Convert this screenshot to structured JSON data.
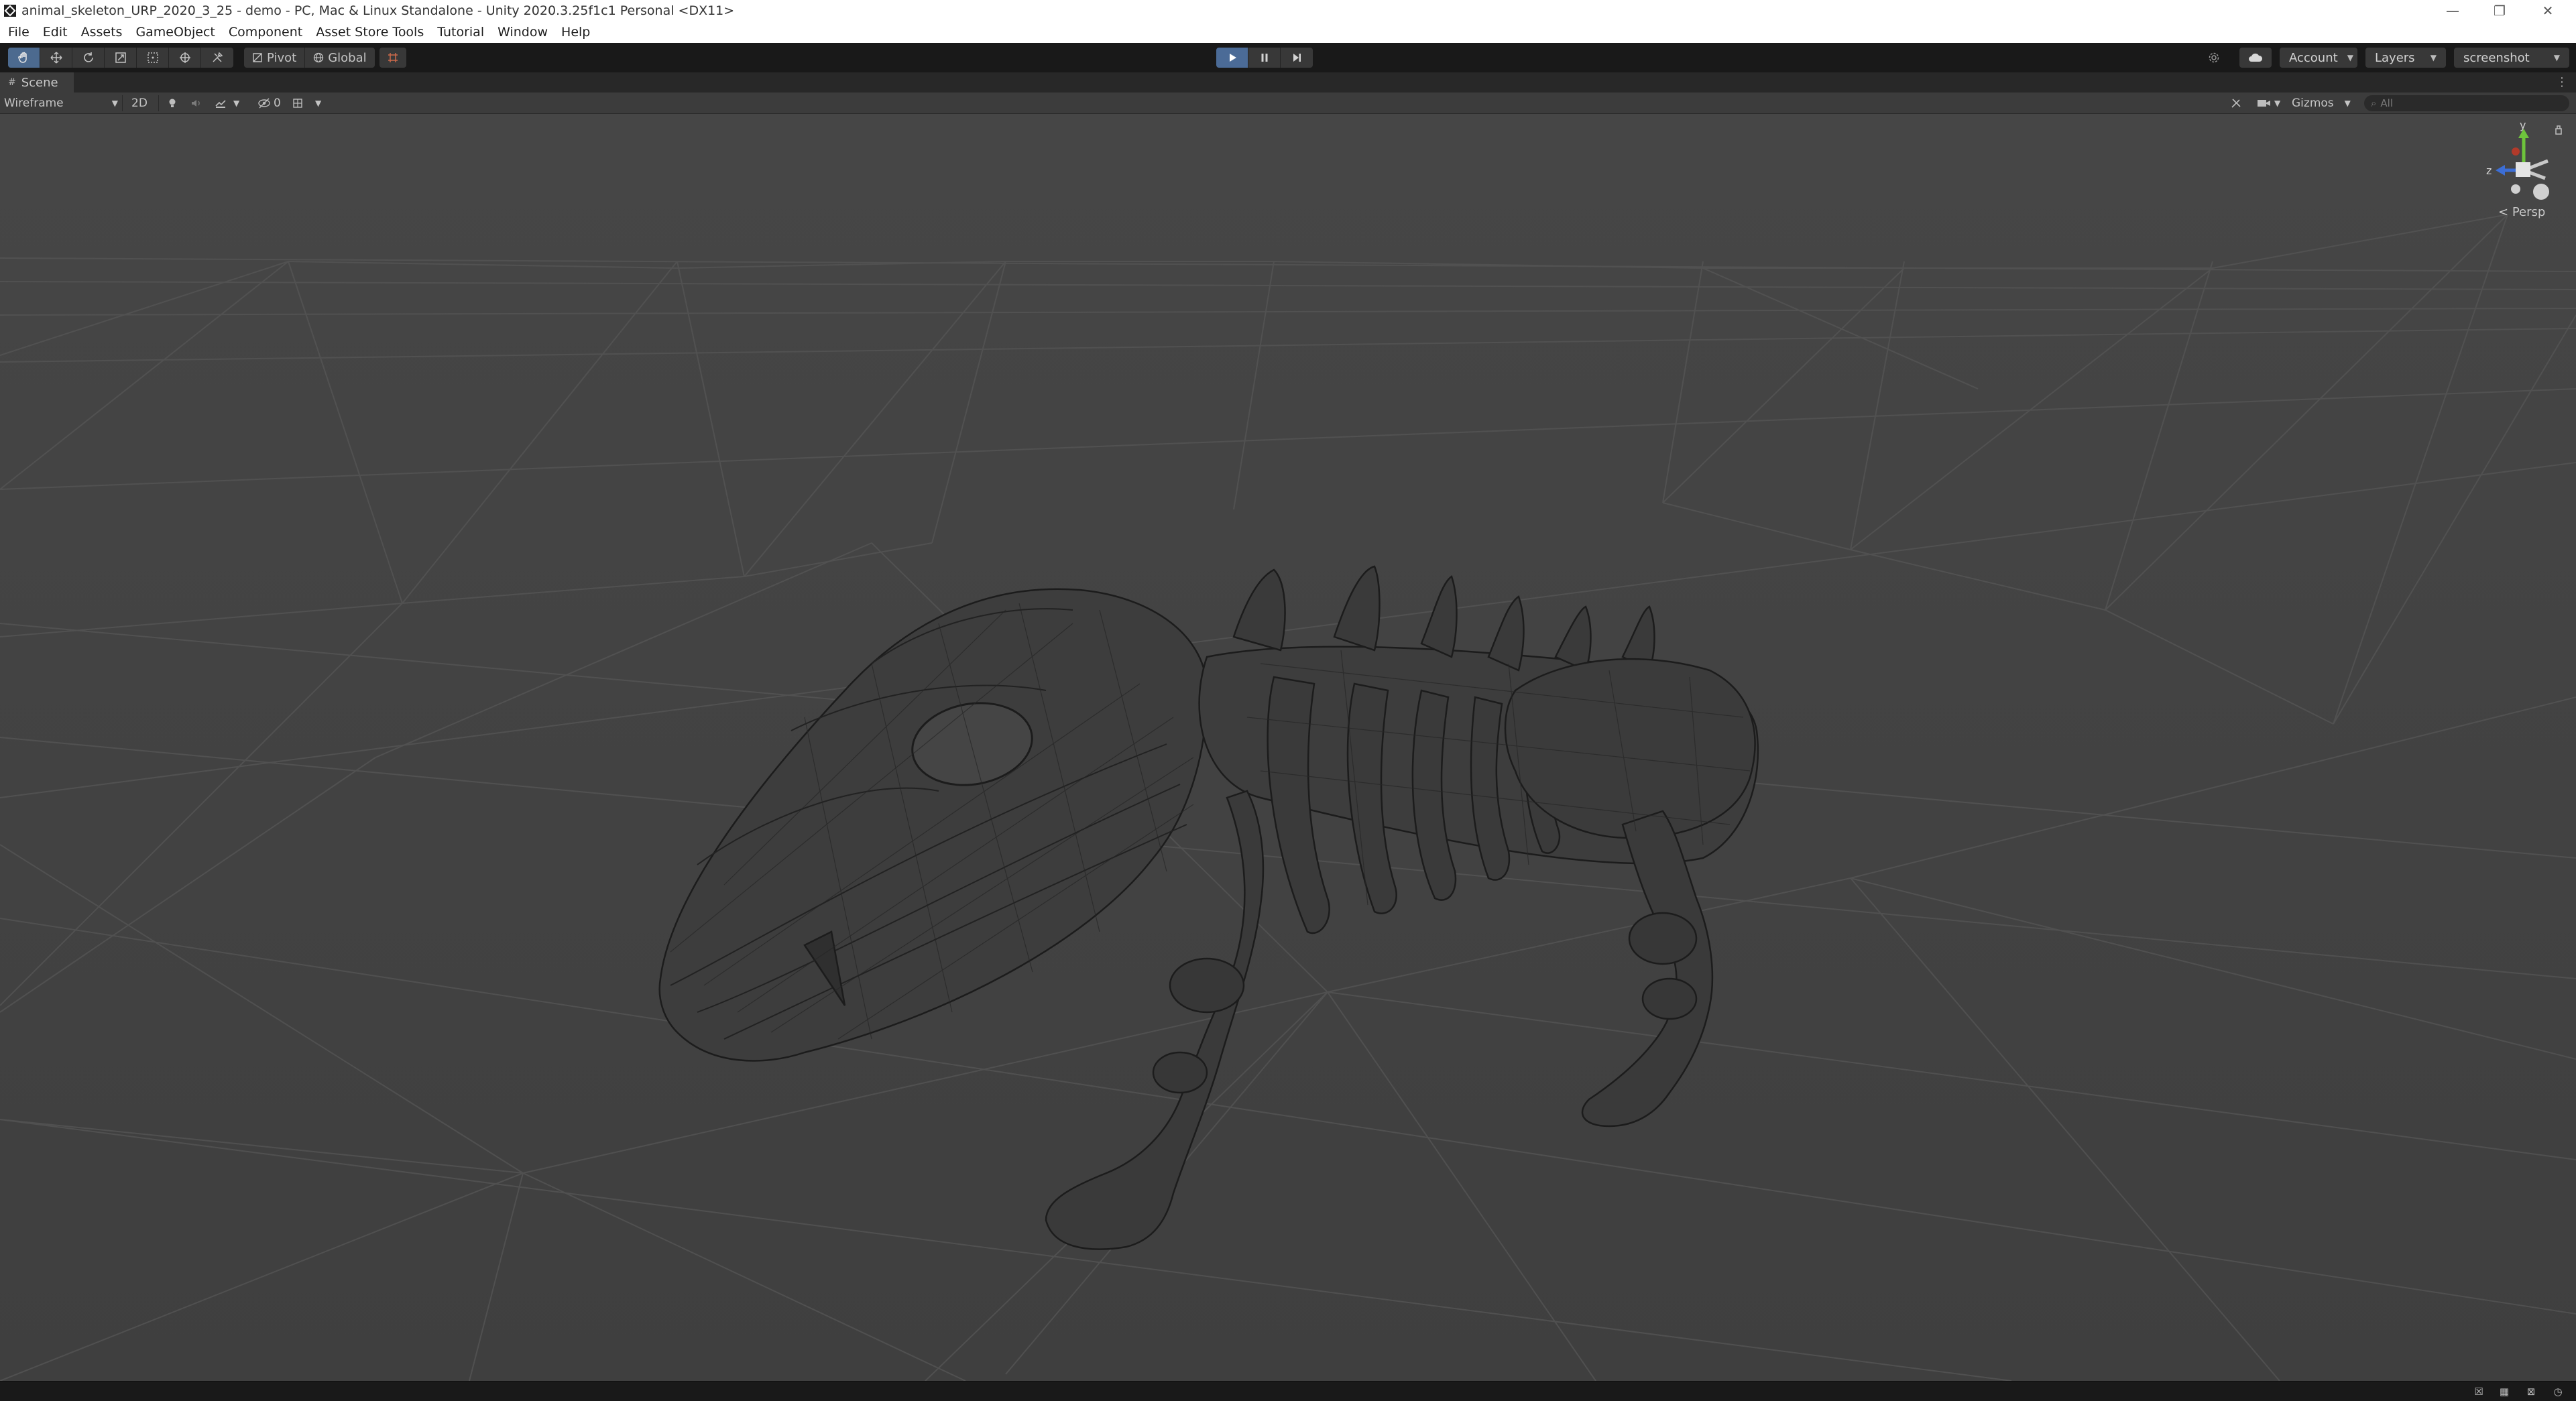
{
  "window": {
    "title": "animal_skeleton_URP_2020_3_25 - demo - PC, Mac & Linux Standalone - Unity 2020.3.25f1c1 Personal <DX11>",
    "controls": {
      "minimize": "—",
      "restore": "❐",
      "close": "✕"
    }
  },
  "menu": {
    "items": [
      "File",
      "Edit",
      "Assets",
      "GameObject",
      "Component",
      "Asset Store Tools",
      "Tutorial",
      "Window",
      "Help"
    ]
  },
  "toolbar": {
    "tools": [
      "hand-tool-icon",
      "move-tool-icon",
      "rotate-tool-icon",
      "scale-tool-icon",
      "rect-tool-icon",
      "transform-tool-icon",
      "custom-tool-icon"
    ],
    "active_tool": "hand-tool-icon",
    "pivot_label": "Pivot",
    "global_label": "Global",
    "playback": {
      "playing": true
    },
    "account_label": "Account",
    "layers_label": "Layers",
    "layout_label": "screenshot",
    "accent_color": "#4b6b97"
  },
  "scene": {
    "tab_label": "Scene",
    "draw_mode": "Wireframe",
    "mode_2d_label": "2D",
    "hidden_count": "0",
    "gizmos_label": "Gizmos",
    "search_placeholder": "All",
    "projection_label": "Persp",
    "axis_labels": {
      "y": "y",
      "z": "z"
    }
  }
}
